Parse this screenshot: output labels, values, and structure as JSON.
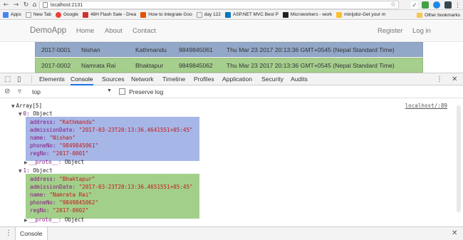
{
  "browser": {
    "url": "localhost:2131",
    "bookmarks": [
      {
        "label": "Apps",
        "color": "#4285f4"
      },
      {
        "label": "New Tab",
        "color": "#9e9e9e"
      },
      {
        "label": "Google",
        "color": "#ea4335"
      },
      {
        "label": "48H Flash Sale - Drea",
        "color": "#d32f2f"
      },
      {
        "label": "How to integrate Goo",
        "color": "#e65100"
      },
      {
        "label": "day 122",
        "color": "#ffffff"
      },
      {
        "label": "ASP.NET MVC Best P",
        "color": "#0277bd"
      },
      {
        "label": "Microworkers - work",
        "color": "#212121"
      },
      {
        "label": "minijobz-Get your m",
        "color": "#fbc02d"
      }
    ],
    "other_bookmarks": "Other bookmarks"
  },
  "app": {
    "brand": "DemoApp",
    "nav": [
      "Home",
      "About",
      "Contact"
    ],
    "register": "Register",
    "login": "Log in"
  },
  "table_rows": [
    {
      "regNo": "2017-0001",
      "name": "Nishan",
      "address": "Kathmandu",
      "phone": "9849845061",
      "date": "Thu Mar 23 2017 20:13:36 GMT+0545 (Nepal Standard Time)",
      "color": "#93a8c8"
    },
    {
      "regNo": "2017-0002",
      "name": "Namrata Rai",
      "address": "Bhaktapur",
      "phone": "9849845062",
      "date": "Thu Mar 23 2017 20:13:36 GMT+0545 (Nepal Standard Time)",
      "color": "#a6cf8e"
    }
  ],
  "devtools": {
    "tabs": [
      "Elements",
      "Console",
      "Sources",
      "Network",
      "Timeline",
      "Profiles",
      "Application",
      "Security",
      "Audits"
    ],
    "active_tab": "Console",
    "context": "top",
    "preserve_log": "Preserve log",
    "drawer_tab": "Console"
  },
  "console": {
    "source_link": "localhost/:89",
    "array_label": "Array[5]",
    "objects": [
      {
        "index": "0",
        "type": "Object",
        "address": "\"Kathmandu\"",
        "admissionDate": "\"2017-03-23T20:13:36.4641551+05:45\"",
        "name": "\"Nishan\"",
        "phoneNo": "\"9849845061\"",
        "regNo": "\"2017-0001\"",
        "highlight": "#a6b6e7"
      },
      {
        "index": "1",
        "type": "Object",
        "address": "\"Bhaktapur\"",
        "admissionDate": "\"2017-03-23T20:13:36.4651551+05:45\"",
        "name": "\"Namrata Rai\"",
        "phoneNo": "\"9849845062\"",
        "regNo": "\"2017-0002\"",
        "highlight": "#a2d08a"
      }
    ],
    "keys": {
      "address": "address:",
      "admissionDate": "admissionDate:",
      "name": "name:",
      "phoneNo": "phoneNo:",
      "regNo": "regNo:"
    },
    "proto_label": "__proto__:",
    "proto_value": "Object"
  }
}
